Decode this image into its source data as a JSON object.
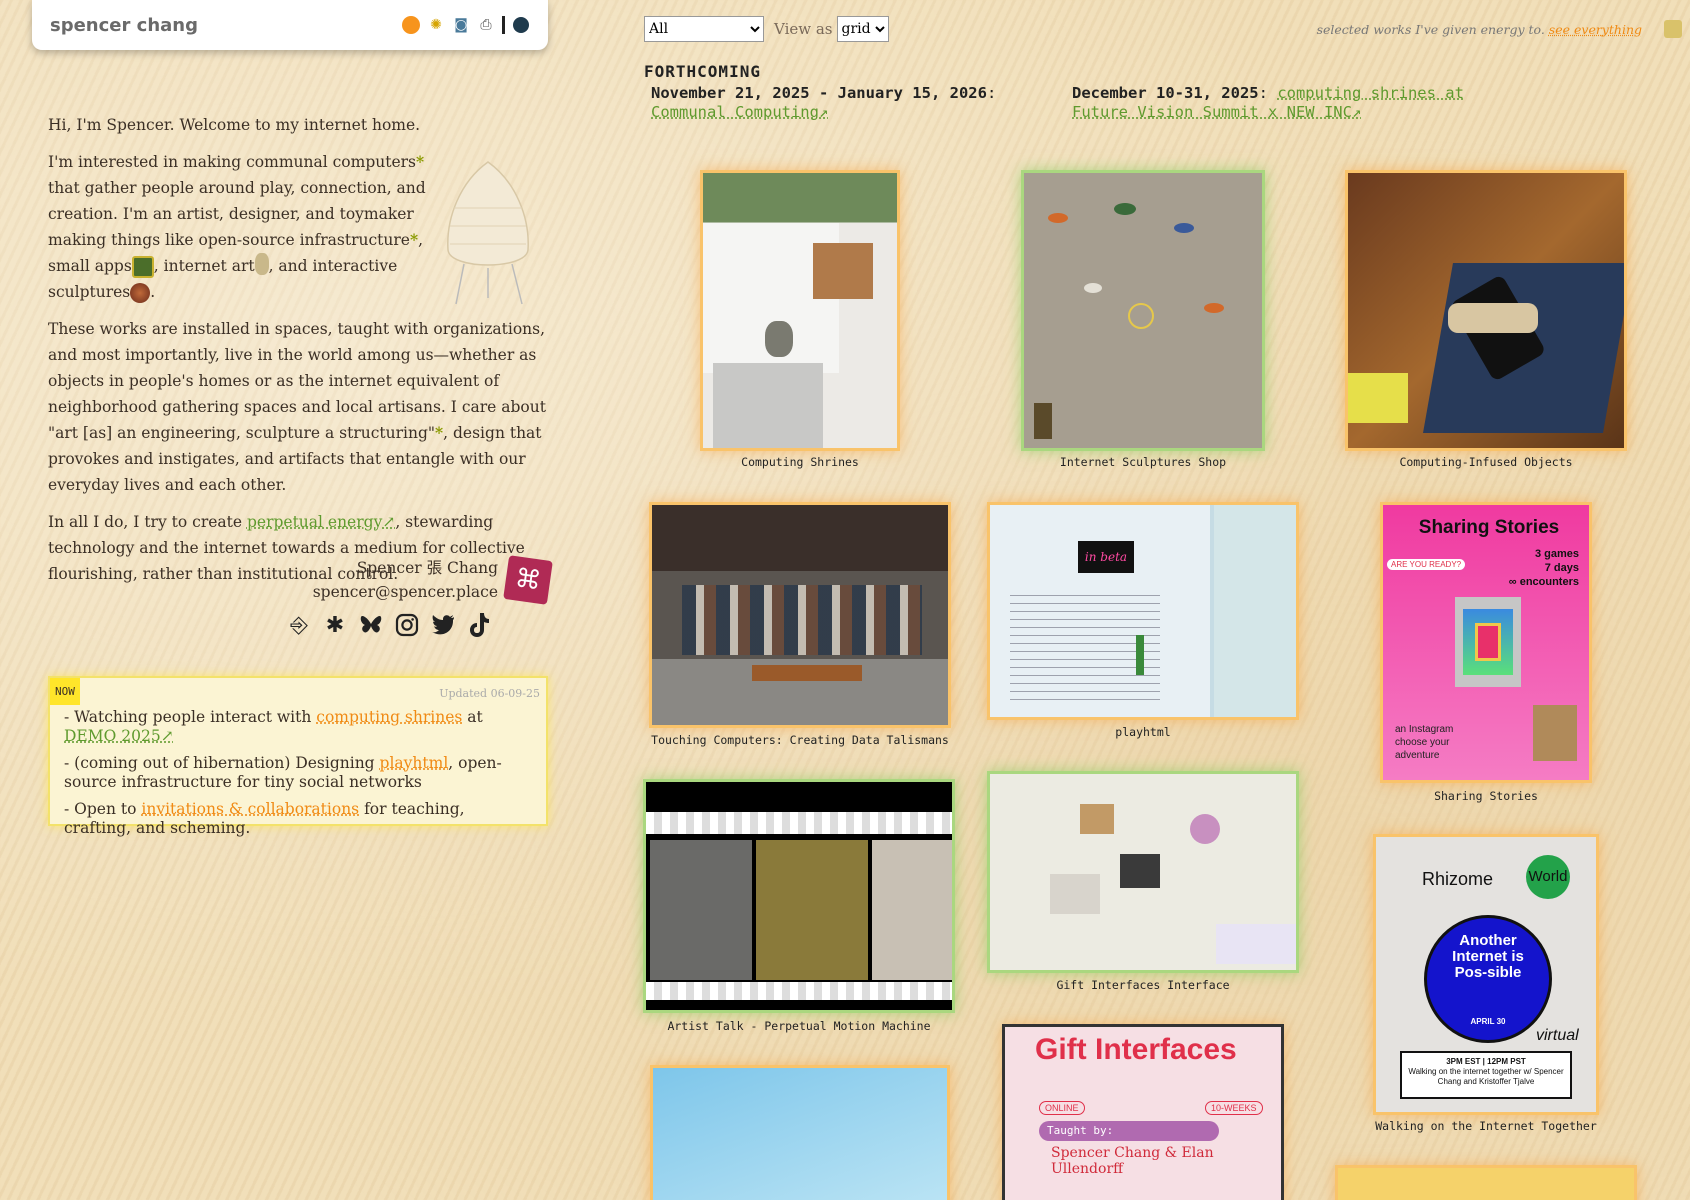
{
  "header": {
    "title": "spencer chang",
    "icons": [
      "orange-circle-icon",
      "sunflower-icon",
      "camera-icon",
      "printer-icon",
      "divider-bar-icon",
      "dark-circle-icon"
    ]
  },
  "intro": {
    "greeting": "Hi, I'm Spencer. Welcome to my internet home.",
    "p2_a": "I'm interested in making communal computers",
    "p2_b": " that gather people around play, connection, and creation. I'm an artist, designer, and toymaker making things like open-source infrastructure",
    "p2_c": ", small apps",
    "p2_d": ", internet art",
    "p2_e": ", and interactive sculptures",
    "p2_f": ".",
    "asterisk": "*",
    "p3_a": "These works are installed in spaces, taught with organizations, and most importantly, live in the world among us—whether as objects in people's homes or as the internet equivalent of neighborhood gathering spaces and local artisans. I care about \"art [as] an engineering, sculpture a structuring\"",
    "p3_b": ", design that provokes and instigates, and artifacts that entangle with our everyday lives and each other.",
    "p4_a": "In all I do, I try to create ",
    "p4_link": "perpetual energy↗",
    "p4_b": ", stewarding technology and the internet towards a medium for collective flourishing, rather than institutional control."
  },
  "signature": {
    "name": "Spencer 張 Chang",
    "email": "spencer@spencer.place"
  },
  "socials": [
    "mailbox-icon",
    "are-na-icon",
    "bluesky-icon",
    "instagram-icon",
    "twitter-icon",
    "tiktok-icon"
  ],
  "now": {
    "tag": "NOW",
    "updated": "Updated 06-09-25",
    "item1_a": "- Watching people interact with ",
    "item1_link1": "computing shrines",
    "item1_b": " at ",
    "item1_link2": "DEMO 2025↗",
    "item2_a": "- (coming out of hibernation) Designing ",
    "item2_link": "playhtml",
    "item2_b": ", open-source infrastructure for tiny social networks",
    "item3_a": "- Open to ",
    "item3_link": "invitations & collaborations",
    "item3_b": " for teaching, crafting, and scheming."
  },
  "controls": {
    "filter_value": "All",
    "view_label": "View as",
    "view_value": "grid"
  },
  "tagline": {
    "text": "selected works I've given energy to. ",
    "link": "see everything"
  },
  "forthcoming": {
    "title": "FORTHCOMING",
    "item1_date": "November 21, 2025 - January 15, 2026",
    "item1_sep": ": ",
    "item1_link": "Communal Computing↗",
    "item2_date": "December 10-31, 2025",
    "item2_sep": ": ",
    "item2_link": "computing shrines at Future Vision Summit x NEW INC↗"
  },
  "works": [
    {
      "title": "Computing Shrines"
    },
    {
      "title": "Internet Sculptures Shop"
    },
    {
      "title": "Computing-Infused Objects"
    },
    {
      "title": "Touching Computers: Creating Data Talismans"
    },
    {
      "title": "playhtml"
    },
    {
      "title": "Sharing Stories"
    },
    {
      "title": "Artist Talk - Perpetual Motion Machine"
    },
    {
      "title": "Gift Interfaces Interface"
    },
    {
      "title": "Walking on the Internet Together"
    }
  ],
  "thumb_text": {
    "sharing_title": "Sharing Stories",
    "sharing_stats": "3 games\n7 days\n∞ encounters",
    "sharing_ready": "ARE YOU READY?",
    "sharing_desc": "an Instagram choose your adventure",
    "rhizome": "Rhizome",
    "world": "World",
    "another": "Another Internet is Pos-sible",
    "april": "APRIL 30",
    "virtual": "virtual",
    "walk_time": "3PM EST | 12PM PST",
    "walk_desc": "Walking on the internet together w/ Spencer Chang and Kristoffer Tjalve",
    "playhtml_beta": "in beta",
    "gift_title": "Gift Interfaces",
    "gift_online": "ONLINE",
    "gift_weeks": "10-WEEKS",
    "gift_taught": "Taught by:",
    "gift_names": "Spencer Chang & Elan Ullendorff"
  },
  "colors": {
    "accent_green": "#5f9a2e",
    "accent_orange": "#f08a14",
    "now_yellow": "#ffe52a",
    "background": "#efdcb5"
  }
}
